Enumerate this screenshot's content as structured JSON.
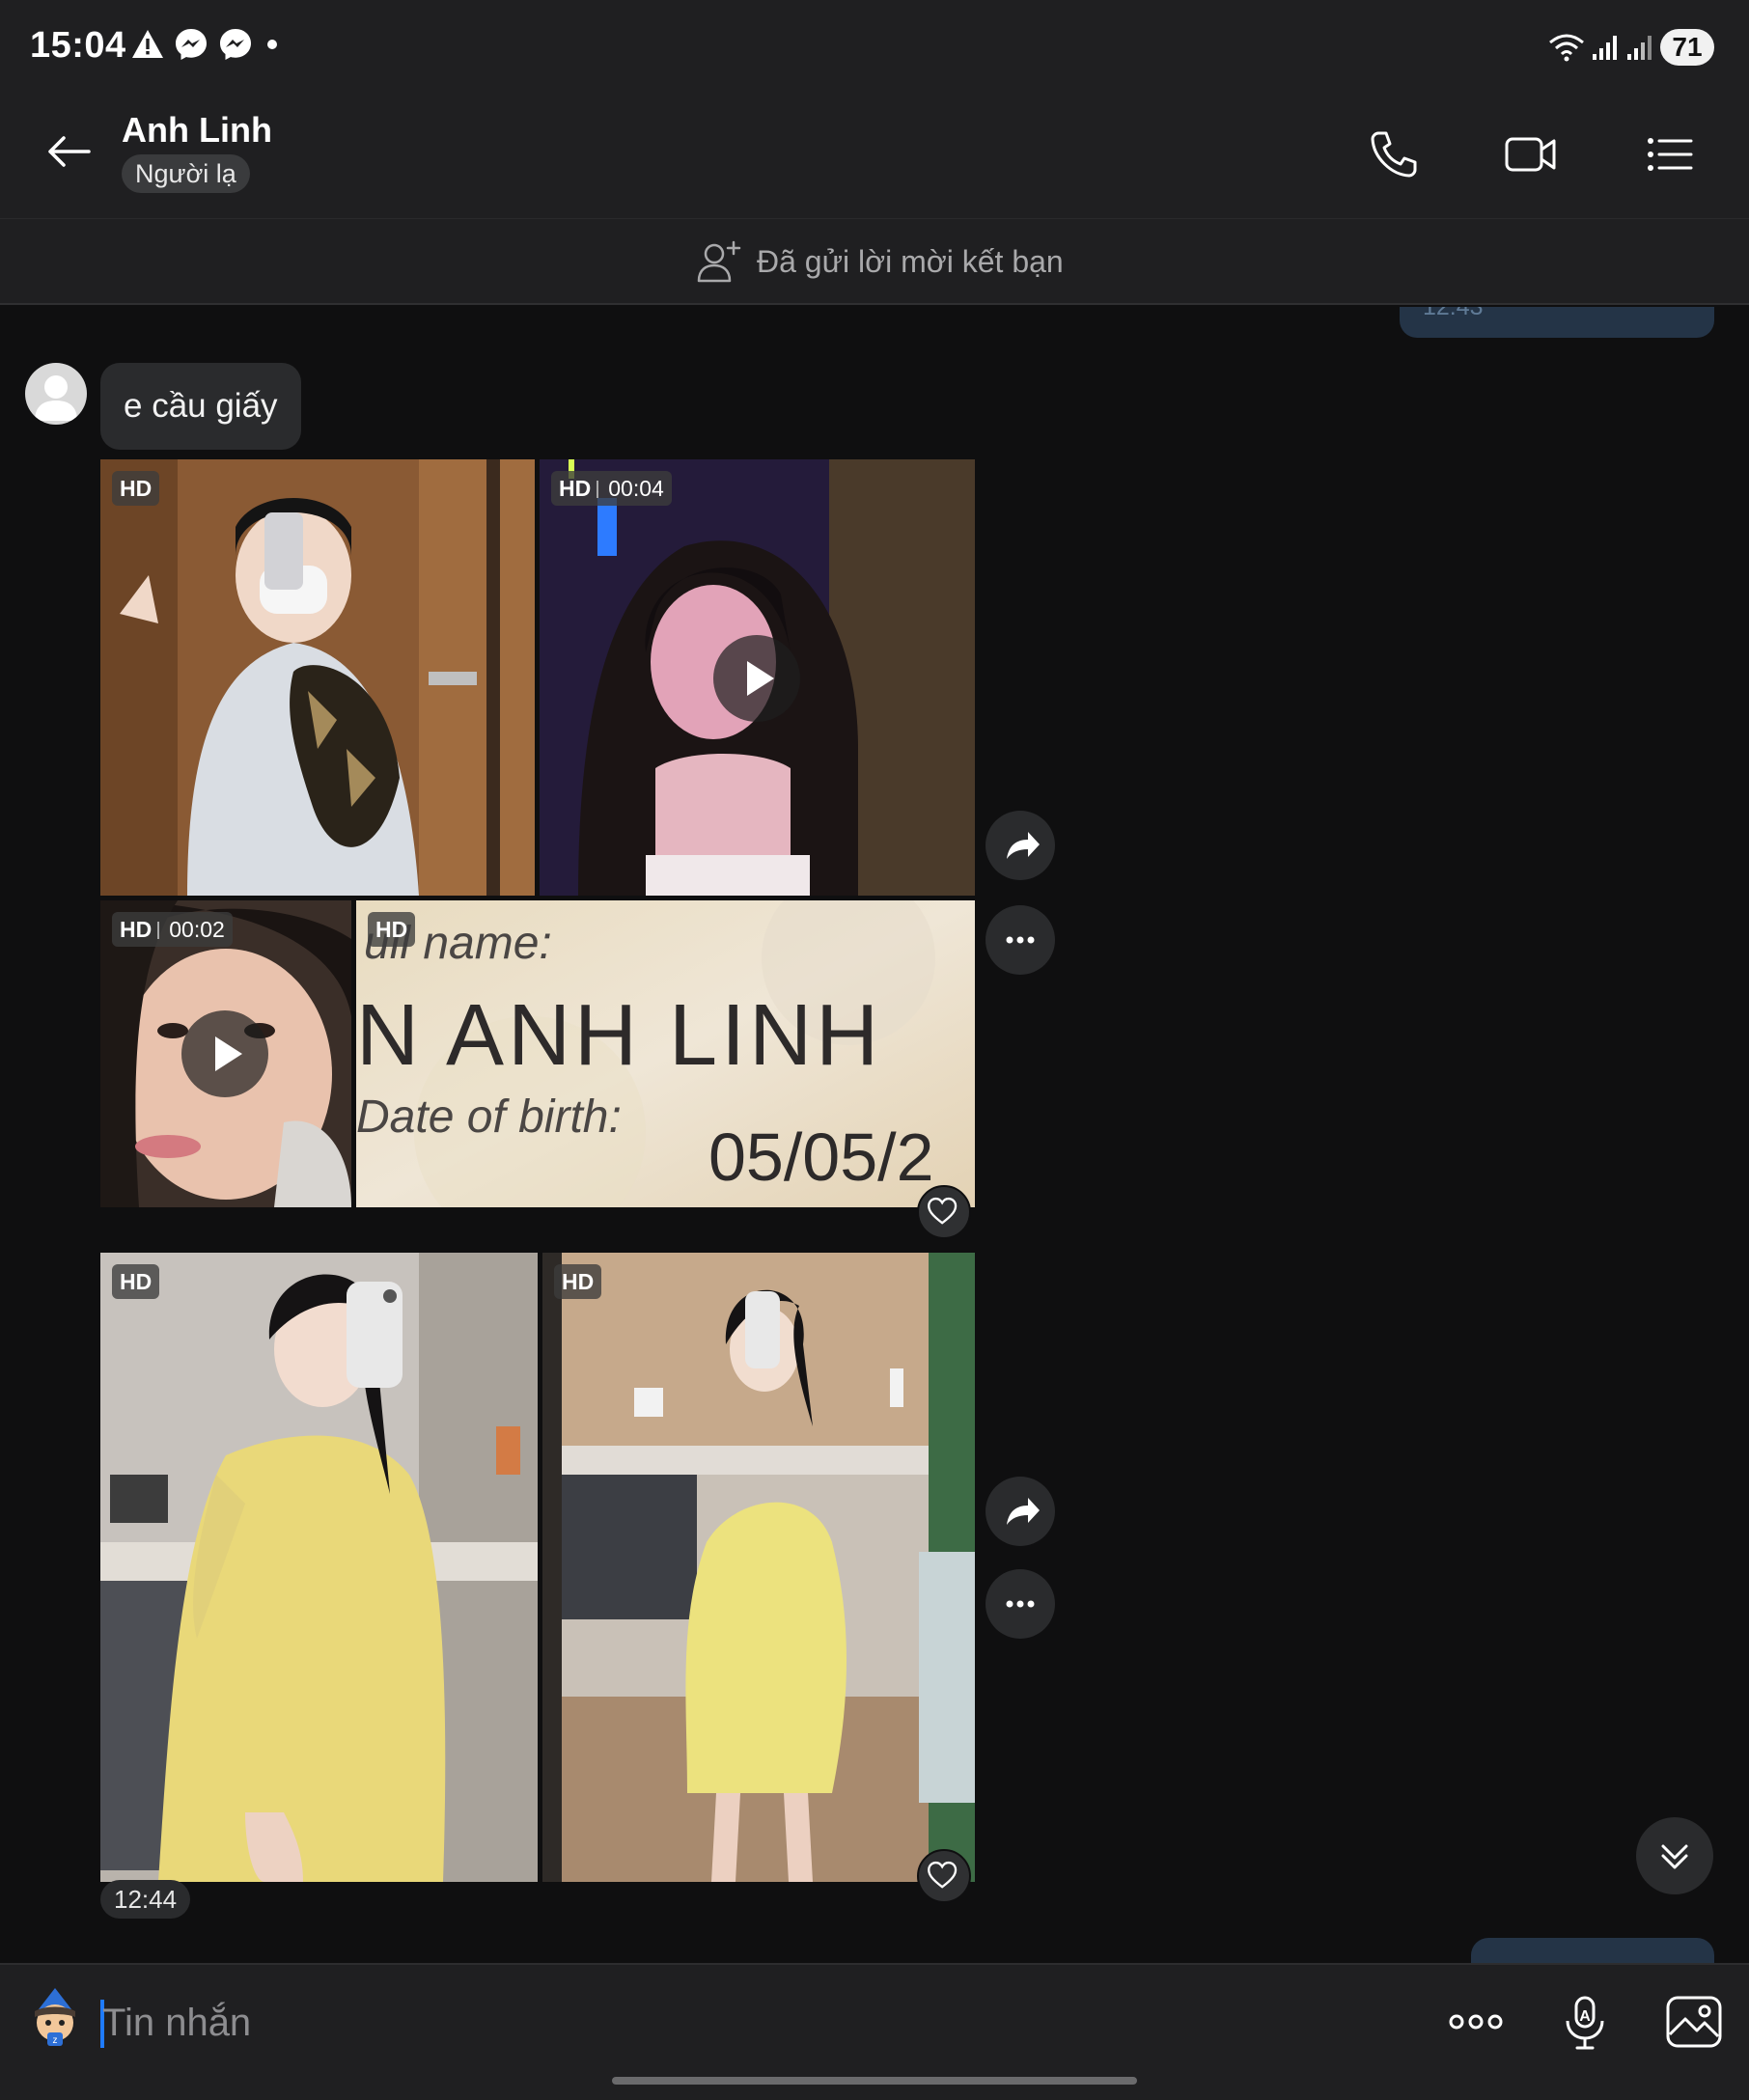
{
  "status_bar": {
    "time": "15:04",
    "battery": "71"
  },
  "header": {
    "contact_name": "Anh Linh",
    "badge": "Người lạ"
  },
  "friend_bar": {
    "text": "Đã gửi lời mời kết bạn"
  },
  "chat": {
    "previous_sent_time": "12:43",
    "received_text": "e cầu giấy",
    "album1": [
      {
        "badge": "HD",
        "duration": ""
      },
      {
        "badge": "HD",
        "duration": "00:04"
      },
      {
        "badge": "HD",
        "duration": "00:02"
      },
      {
        "badge": "HD",
        "duration": ""
      }
    ],
    "id_card": {
      "line1": "ull name:",
      "line2": "N ANH LINH",
      "line3": "Date of birth:",
      "line4": "05/05/2"
    },
    "album2": [
      {
        "badge": "HD"
      },
      {
        "badge": "HD"
      }
    ],
    "time": "12:44"
  },
  "input": {
    "placeholder": "Tin nhắn"
  },
  "colors": {
    "background": "#0f0f10",
    "bar": "#1f1f21",
    "bubble": "#2a2b2d",
    "caret": "#1f7bff",
    "sent_bubble": "#243447"
  }
}
